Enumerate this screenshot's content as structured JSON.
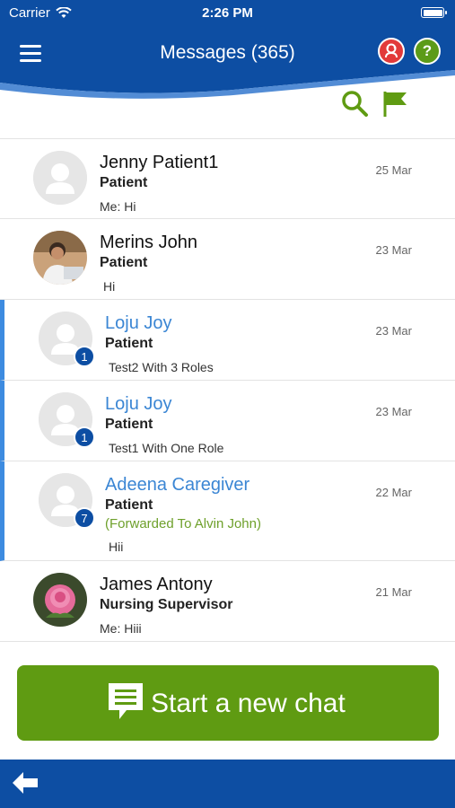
{
  "status": {
    "carrier": "Carrier",
    "time": "2:26 PM"
  },
  "header": {
    "title": "Messages (365)",
    "help_symbol": "?"
  },
  "colors": {
    "primary_blue": "#0d4ea3",
    "accent_green": "#5f9b12",
    "unread_blue": "#3b86d4",
    "alert_red": "#e23a3a",
    "forward_green": "#6ea02b"
  },
  "icons": [
    "menu-icon",
    "alert-icon",
    "help-icon",
    "search-icon",
    "flag-icon",
    "chat-icon",
    "back-arrow-icon"
  ],
  "messages": [
    {
      "name": "Jenny Patient1",
      "role": "Patient",
      "preview": "Me: Hi",
      "date": "25 Mar",
      "unread": false,
      "badge": ""
    },
    {
      "name": "Merins John",
      "role": "Patient",
      "preview": "Hi",
      "date": "23 Mar",
      "unread": false,
      "badge": ""
    },
    {
      "name": "Loju Joy",
      "role": "Patient",
      "preview": "Test2 With 3 Roles",
      "date": "23 Mar",
      "unread": true,
      "badge": "1"
    },
    {
      "name": "Loju Joy",
      "role": "Patient",
      "preview": "Test1 With One Role",
      "date": "23 Mar",
      "unread": true,
      "badge": "1"
    },
    {
      "name": "Adeena Caregiver",
      "role": "Patient",
      "forwarded": "(Forwarded To Alvin John)",
      "preview": "Hii",
      "date": "22 Mar",
      "unread": true,
      "badge": "7"
    },
    {
      "name": "James Antony",
      "role": "Nursing Supervisor",
      "preview": "Me: Hiii",
      "date": "21 Mar",
      "unread": false,
      "badge": ""
    }
  ],
  "start_chat": {
    "label": "Start a new chat"
  }
}
